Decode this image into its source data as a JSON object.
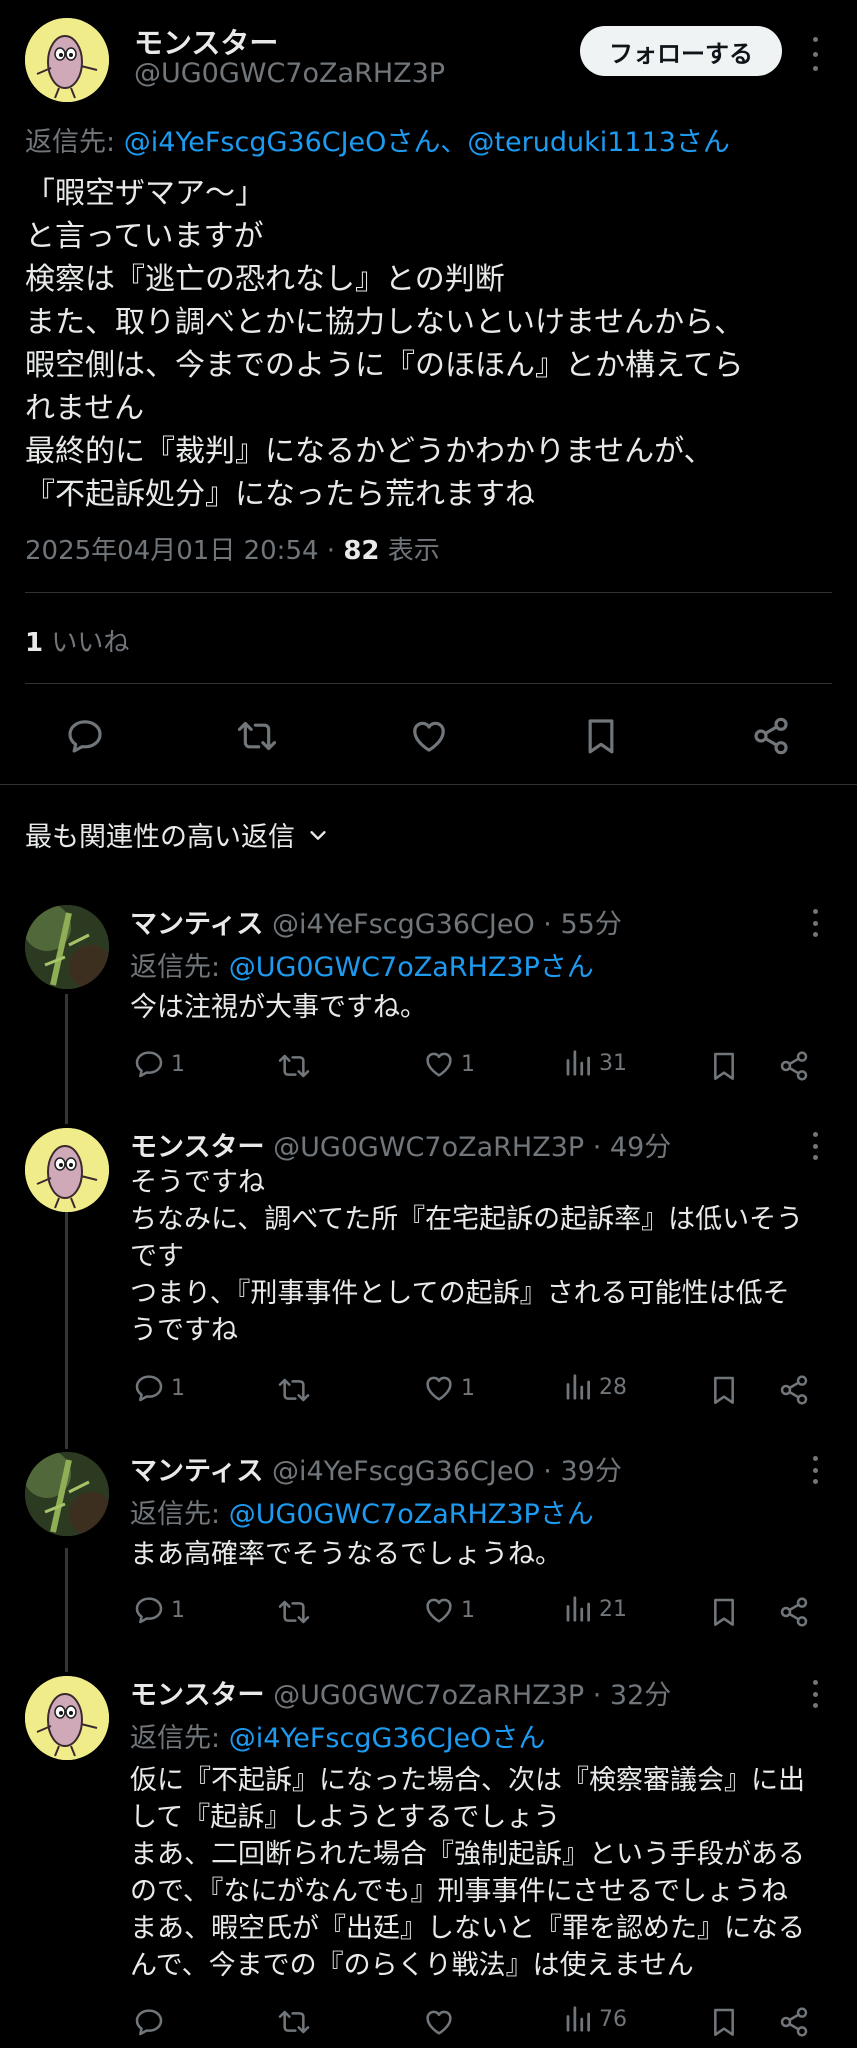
{
  "main_post": {
    "author_name": "モンスター",
    "author_handle": "@UG0GWC7oZaRHZ3P",
    "follow_label": "フォローする",
    "reply_label": "返信先: ",
    "reply_targets": "@i4YeFscgG36CJeOさん、@teruduki1113さん",
    "text_lines": [
      "「暇空ザマア〜」",
      "と言っていますが",
      "検察は『逃亡の恐れなし』との判断",
      "また、取り調べとかに協力しないといけませんから、",
      "暇空側は、今までのように『のほほん』とか構えてら",
      "れません",
      "最終的に『裁判』になるかどうかわかりませんが、",
      "『不起訴処分』になったら荒れますね"
    ],
    "timestamp": "2025年04月01日 20:54 · ",
    "views_count": "82",
    "views_label": " 表示",
    "likes_count": "1",
    "likes_label": " いいね"
  },
  "sort_label": "最も関連性の高い返信",
  "replies": [
    {
      "name": "マンティス",
      "handle": "@i4YeFscgG36CJeO · 55分",
      "reply_label": "返信先: ",
      "reply_to": "@UG0GWC7oZaRHZ3Pさん",
      "text_lines": [
        "今は注視が大事ですね。"
      ],
      "reply_count": "1",
      "like_count": "1",
      "view_count": "31"
    },
    {
      "name": "モンスター",
      "handle": "@UG0GWC7oZaRHZ3P · 49分",
      "text_lines": [
        "そうですね",
        "ちなみに、調べてた所『在宅起訴の起訴率』は低いそう",
        "です",
        "つまり、『刑事事件としての起訴』される可能性は低そ",
        "うですね"
      ],
      "reply_count": "1",
      "like_count": "1",
      "view_count": "28"
    },
    {
      "name": "マンティス",
      "handle": "@i4YeFscgG36CJeO · 39分",
      "reply_label": "返信先: ",
      "reply_to": "@UG0GWC7oZaRHZ3Pさん",
      "text_lines": [
        "まあ高確率でそうなるでしょうね。"
      ],
      "reply_count": "1",
      "like_count": "1",
      "view_count": "21"
    },
    {
      "name": "モンスター",
      "handle": "@UG0GWC7oZaRHZ3P · 32分",
      "reply_label": "返信先: ",
      "reply_to": "@i4YeFscgG36CJeOさん",
      "text_lines": [
        "仮に『不起訴』になった場合、次は『検察審議会』に出",
        "して『起訴』しようとするでしょう",
        "まあ、二回断られた場合『強制起訴』という手段がある",
        "ので、『なにがなんでも』刑事事件にさせるでしょうね",
        "まあ、暇空氏が『出廷』しないと『罪を認めた』になる",
        "んで、今までの『のらくり戦法』は使えません"
      ],
      "view_count": "76"
    }
  ],
  "colors": {
    "background": "#000000",
    "text": "#e7e9ea",
    "muted": "#71767b",
    "link": "#1d9bf0",
    "divider": "#2f3336"
  },
  "icons": [
    "reply-icon",
    "retweet-icon",
    "like-icon",
    "bookmark-icon",
    "share-icon",
    "views-icon",
    "more-icon",
    "chevron-down-icon"
  ]
}
